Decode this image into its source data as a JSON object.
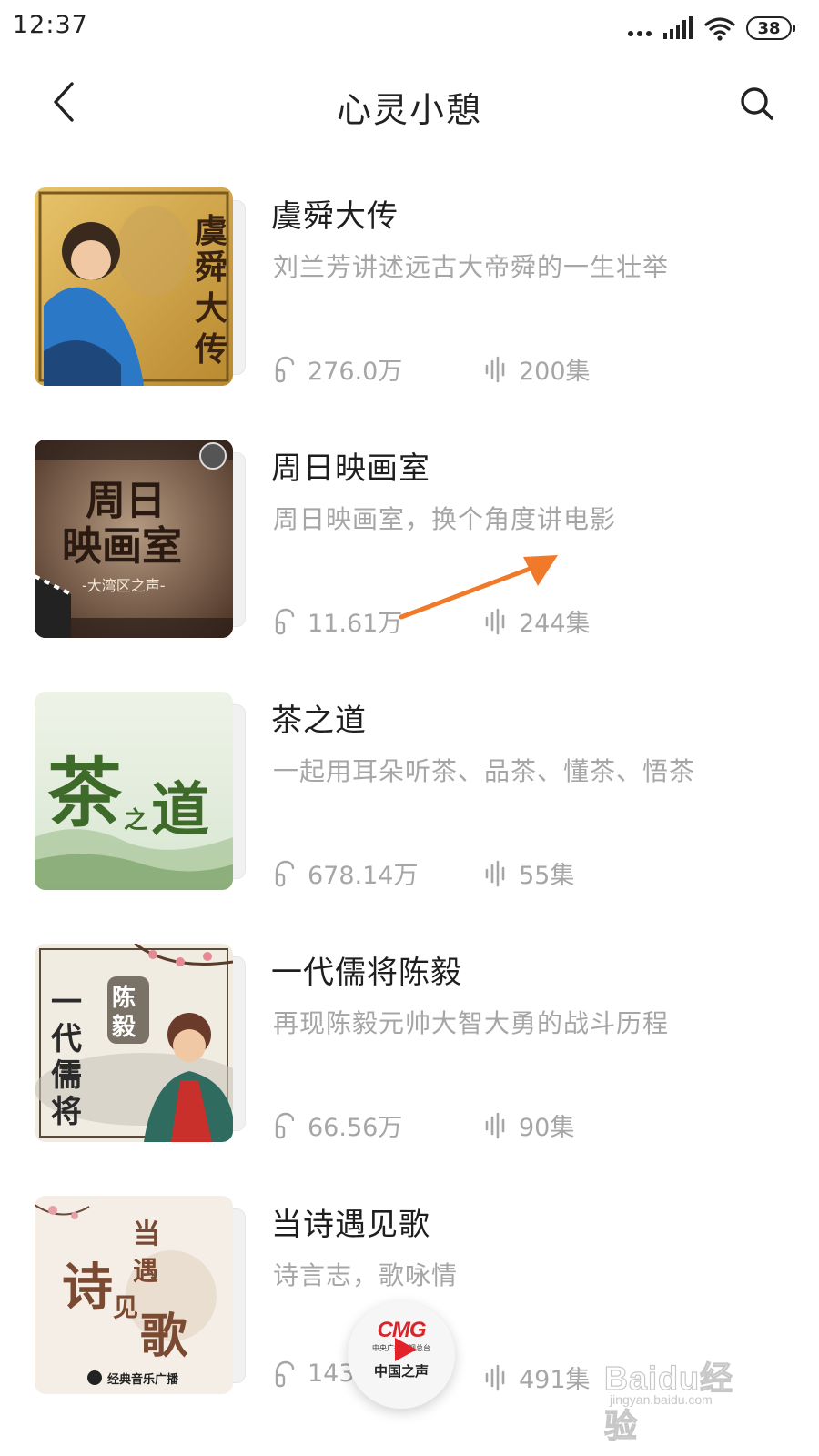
{
  "status_bar": {
    "time": "12:37",
    "battery": "38"
  },
  "header": {
    "title": "心灵小憩"
  },
  "albums": [
    {
      "title": "虞舜大传",
      "description": "刘兰芳讲述远古大帝舜的一生壮举",
      "plays": "276.0万",
      "episodes": "200集",
      "cover_text": "虞舜大传"
    },
    {
      "title": "周日映画室",
      "description": "周日映画室，换个角度讲电影",
      "plays": "11.61万",
      "episodes": "244集",
      "cover_text_line1": "周日",
      "cover_text_line2": "映画室",
      "cover_sub": "-大湾区之声-"
    },
    {
      "title": "茶之道",
      "description": "一起用耳朵听茶、品茶、懂茶、悟茶",
      "plays": "678.14万",
      "episodes": "55集",
      "cover_text": "茶之道"
    },
    {
      "title": "一代儒将陈毅",
      "description": "再现陈毅元帅大智大勇的战斗历程",
      "plays": "66.56万",
      "episodes": "90集",
      "cover_text_line1": "一代儒将",
      "cover_text_line2": "陈毅"
    },
    {
      "title": "当诗遇见歌",
      "description": "诗言志，歌咏情",
      "plays": "143.",
      "episodes": "491集",
      "cover_text": "当诗遇见歌",
      "cover_sub": "经典音乐广播"
    }
  ],
  "mini_player": {
    "logo": "CMG",
    "subtitle": "中央广播电视总台",
    "station": "中国之声"
  },
  "watermark": {
    "brand": "Baidu经验",
    "url": "jingyan.baidu.com"
  },
  "colors": {
    "annotation_arrow": "#f07a2a",
    "text_secondary": "#a6a6a6",
    "cmg_red": "#d6262c"
  }
}
